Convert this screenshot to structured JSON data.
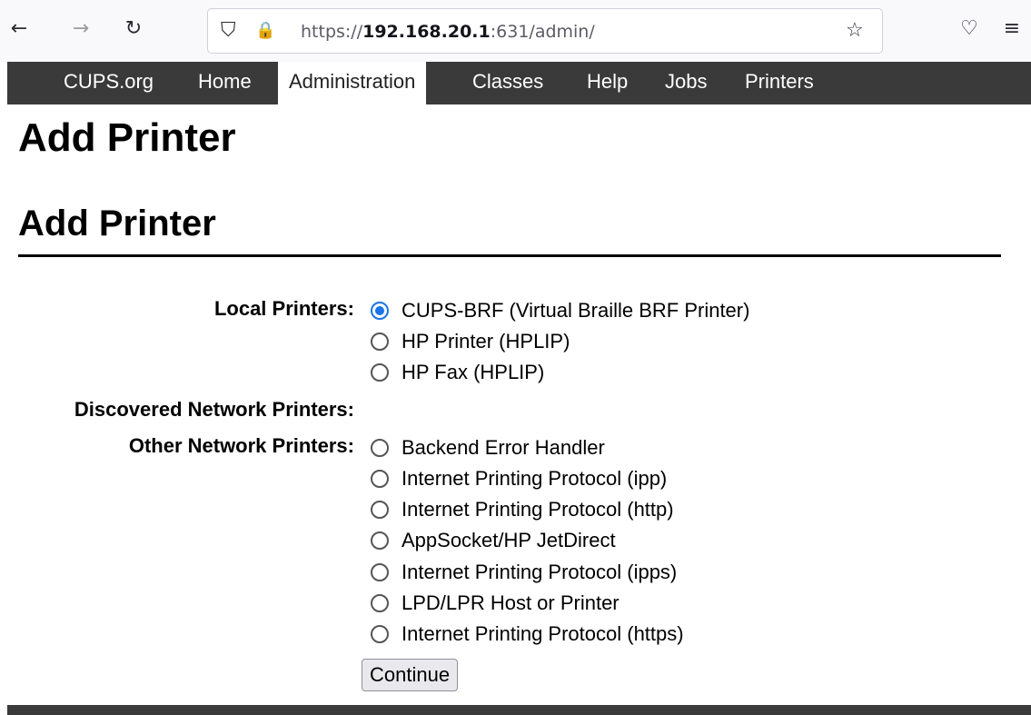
{
  "browser": {
    "back_icon": "←",
    "forward_icon": "→",
    "reload_icon": "↻",
    "shield_icon": "⛉",
    "lock_icon": "🔒",
    "url_scheme": "https://",
    "url_host": "192.168.20.1",
    "url_rest": ":631/admin/",
    "star_icon": "☆",
    "pocket_icon": "♡",
    "menu_icon": "≡"
  },
  "nav": {
    "items": [
      {
        "label": "CUPS.org"
      },
      {
        "label": "Home"
      },
      {
        "label": "Administration"
      },
      {
        "label": "Classes"
      },
      {
        "label": "Help"
      },
      {
        "label": "Jobs"
      },
      {
        "label": "Printers"
      }
    ],
    "active": "Administration"
  },
  "page": {
    "title": "Add Printer",
    "section_title": "Add Printer"
  },
  "form": {
    "local_label": "Local Printers:",
    "local_options": [
      {
        "label": "CUPS-BRF (Virtual Braille BRF Printer)",
        "checked": true
      },
      {
        "label": "HP Printer (HPLIP)",
        "checked": false
      },
      {
        "label": "HP Fax (HPLIP)",
        "checked": false
      }
    ],
    "discovered_label": "Discovered Network Printers:",
    "other_label": "Other Network Printers:",
    "other_options": [
      {
        "label": "Backend Error Handler",
        "checked": false
      },
      {
        "label": "Internet Printing Protocol (ipp)",
        "checked": false
      },
      {
        "label": "Internet Printing Protocol (http)",
        "checked": false
      },
      {
        "label": "AppSocket/HP JetDirect",
        "checked": false
      },
      {
        "label": "Internet Printing Protocol (ipps)",
        "checked": false
      },
      {
        "label": "LPD/LPR Host or Printer",
        "checked": false
      },
      {
        "label": "Internet Printing Protocol (https)",
        "checked": false
      }
    ],
    "continue_label": "Continue"
  },
  "colors": {
    "nav_bg": "#3a3a3a",
    "radio_accent": "#1a73e8"
  }
}
